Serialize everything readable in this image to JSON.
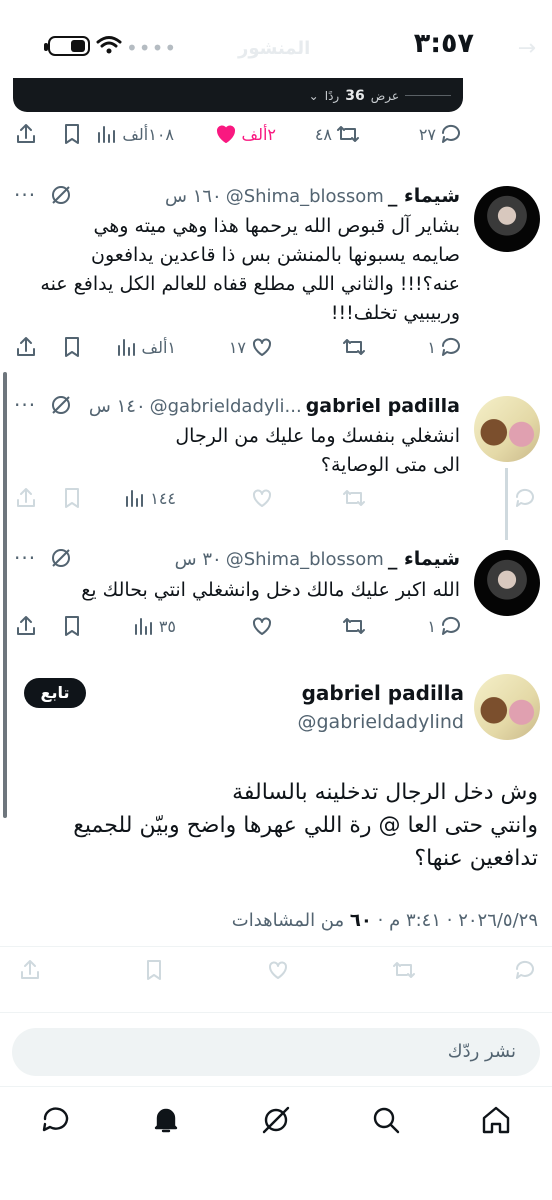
{
  "status_bar": {
    "time": "٣:٥٧",
    "icons": [
      "battery-icon",
      "wifi-icon",
      "signal-dots-icon"
    ]
  },
  "header": {
    "title": "المنشور",
    "back_icon": "arrow-right-icon"
  },
  "video_bar": {
    "show_replies_label": "عرض",
    "show_replies_count": "36",
    "show_replies_suffix": "ردًا"
  },
  "top_actions": {
    "replies": "٢٧",
    "reposts": "٤٨",
    "likes": "٢ألف",
    "views": "١٠٨ألف"
  },
  "tweets": [
    {
      "name": "شيماء _",
      "handle": "@Shima_blossom",
      "time": "١٦٠ س",
      "text_lines": [
        "بشاير آل قبوص الله يرحمها هذا وهي ميته وهي",
        "صايمه يسبونها بالمنشن بس ذا قاعدين يدافعون",
        "عنه؟!!! والثاني اللي مطلع قفاه للعالم الكل يدافع عنه",
        "وربيبيي تخلف!!!"
      ],
      "replies": "١",
      "reposts": "",
      "likes": "١٧",
      "views": "١ألف"
    },
    {
      "name": "gabriel padilla",
      "handle": "@gabrieldadyli...",
      "time": "١٤٠ س",
      "text_lines": [
        "انشغلي بنفسك وما عليك من الرجال",
        "الى متى الوصاية؟"
      ],
      "replies": "",
      "reposts": "",
      "likes": "",
      "views": "١٤٤"
    },
    {
      "name": "شيماء _",
      "handle": "@Shima_blossom",
      "time": "٣٠ س",
      "text_lines": [
        "الله اكبر عليك مالك دخل وانشغلي انتي بحالك يع"
      ],
      "replies": "١",
      "reposts": "",
      "likes": "",
      "views": "٣٥"
    }
  ],
  "main_tweet": {
    "name": "gabriel padilla",
    "handle": "@gabrieldadylind",
    "follow_label": "تابع",
    "text_lines": [
      "وش دخل الرجال تدخلينه بالسالفة",
      "وانتي حتى العا @ رة اللي عهرها واضح وبيّن للجميع",
      "تدافعين عنها؟"
    ],
    "date": "٢٠٢٦/٥/٢٩ · ٣:٤١ م",
    "views_count": "٦٠",
    "views_label": "من المشاهدات"
  },
  "reply_box": {
    "placeholder": "نشر ردّك"
  },
  "bottom_nav": [
    "home-icon",
    "search-icon",
    "grok-icon",
    "notifications-icon",
    "messages-icon"
  ]
}
